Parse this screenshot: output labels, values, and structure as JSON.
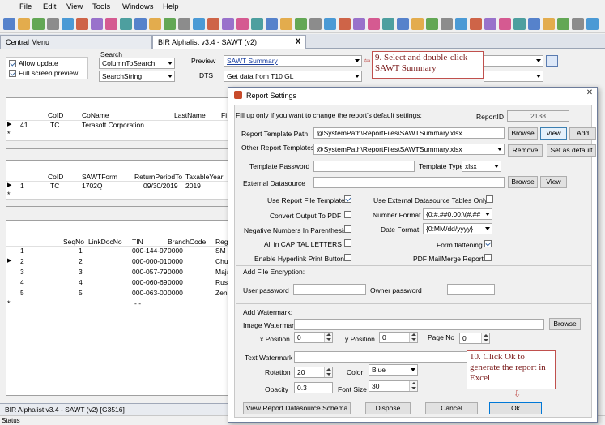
{
  "menu": [
    "File",
    "Edit",
    "View",
    "Tools",
    "Windows",
    "Help"
  ],
  "toolbar_icons": [
    "new-icon",
    "open-icon",
    "save-icon",
    "print-icon",
    "preview-icon",
    "search-icon",
    "upload-icon",
    "calculator-icon",
    "refresh-icon",
    "undo-icon",
    "find-icon",
    "cut-icon",
    "copy-icon",
    "paste-icon",
    "grid-icon",
    "help-icon",
    "info-icon",
    "calendar-icon",
    "cm-icon",
    "sort-icon",
    "star-icon",
    "edit-icon",
    "g-icon",
    "settings-icon",
    "mail-icon",
    "chat-icon",
    "key-icon",
    "export-icon",
    "pin-icon",
    "window-icon",
    "bell-icon",
    "chart-icon",
    "zoom-in-icon",
    "zoom-out-icon",
    "tag-icon",
    "close-icon",
    "filter-icon",
    "filter-edit-icon",
    "filter-clear-icon",
    "funnel-icon",
    "funnel-add-icon"
  ],
  "tabs": {
    "central": "Central Menu",
    "alphalist": "BIR Alphalist v3.4 - SAWT (v2)",
    "close": "X"
  },
  "options": {
    "allow_update": "Allow update",
    "full_screen": "Full screen preview"
  },
  "search": {
    "label": "Search",
    "column": "ColumnToSearch",
    "string": "SearchString"
  },
  "preview": {
    "label": "Preview",
    "value": "SAWT Summary"
  },
  "dts": {
    "label": "DTS",
    "value": "Get data from T10 GL"
  },
  "callout_top": "9. Select and double-click SAWT Summary",
  "callout_bottom": "10. Click Ok to generate the report in Excel",
  "grid1": {
    "headers": [
      "CoID",
      "CoName",
      "LastName",
      "Fi"
    ],
    "row": [
      "41",
      "TC",
      "Terasoft Corporation"
    ]
  },
  "grid2": {
    "headers": [
      "CoID",
      "SAWTForm",
      "ReturnPeriodTo",
      "TaxableYear"
    ],
    "row": [
      "1",
      "TC",
      "1702Q",
      "09/30/2019",
      "2019"
    ]
  },
  "grid3": {
    "headers": [
      "SeqNo",
      "LinkDocNo",
      "TIN",
      "BranchCode",
      "Reg"
    ],
    "rows": [
      [
        "1",
        "1",
        "000-144-97",
        "0000",
        "SM S"
      ],
      [
        "2",
        "2",
        "000-000-01",
        "0000",
        "Chur"
      ],
      [
        "3",
        "3",
        "000-057-79",
        "0000",
        "Maja"
      ],
      [
        "4",
        "4",
        "000-060-69",
        "0000",
        "Rust"
      ],
      [
        "5",
        "5",
        "000-063-00",
        "0000",
        "Zeni"
      ]
    ],
    "newrow": "-   -"
  },
  "dialog": {
    "title": "Report Settings",
    "instruction": "Fill up only if you want to change the report's default settings:",
    "report_id_label": "ReportID",
    "report_id": "2138",
    "template_path_label": "Report Template Path",
    "template_path": "@SystemPath\\ReportFiles\\SAWTSummary.xlsx",
    "browse": "Browse",
    "view": "View",
    "add": "Add",
    "other_templates_label": "Other Report Templates",
    "other_templates": "@SystemPath\\ReportFiles\\SAWTSummary.xlsx",
    "remove": "Remove",
    "set_default": "Set as default",
    "template_password_label": "Template Password",
    "template_type_label": "Template Type",
    "template_type": "xlsx",
    "external_ds_label": "External Datasource",
    "use_report_file_template": "Use Report File Template",
    "use_external_ds_tables": "Use External Datasource Tables Only",
    "convert_pdf": "Convert Output To PDF",
    "number_format_label": "Number Format",
    "number_format": "{0:#,##0.00;\\(#,##",
    "negative_parenthesis": "Negative Numbers In Parenthesis",
    "date_format_label": "Date Format",
    "date_format": "{0:MM/dd/yyyy}",
    "all_caps": "All in CAPITAL LETTERS",
    "form_flattening": "Form flattening",
    "hyperlink_print": "Enable Hyperlink Print Button",
    "pdf_mailmerge": "PDF MailMerge Report",
    "add_file_encryption": "Add File Encryption:",
    "user_password_label": "User password",
    "owner_password_label": "Owner password",
    "add_watermark": "Add Watermark:",
    "image_watermark_label": "Image Watermark",
    "x_position_label": "x Position",
    "x_position": "0",
    "y_position_label": "y Position",
    "y_position": "0",
    "page_no_label": "Page No",
    "page_no": "0",
    "text_watermark_label": "Text Watermark",
    "rotation_label": "Rotation",
    "rotation": "20",
    "color_label": "Color",
    "color": "Blue",
    "opacity_label": "Opacity",
    "opacity": "0.3",
    "font_size_label": "Font Size",
    "font_size": "30",
    "view_schema": "View Report Datasource Schema",
    "dispose": "Dispose",
    "cancel": "Cancel",
    "ok": "Ok"
  },
  "bottom_tab": "BIR Alphalist v3.4 - SAWT (v2) [G3516]",
  "status": "Status"
}
